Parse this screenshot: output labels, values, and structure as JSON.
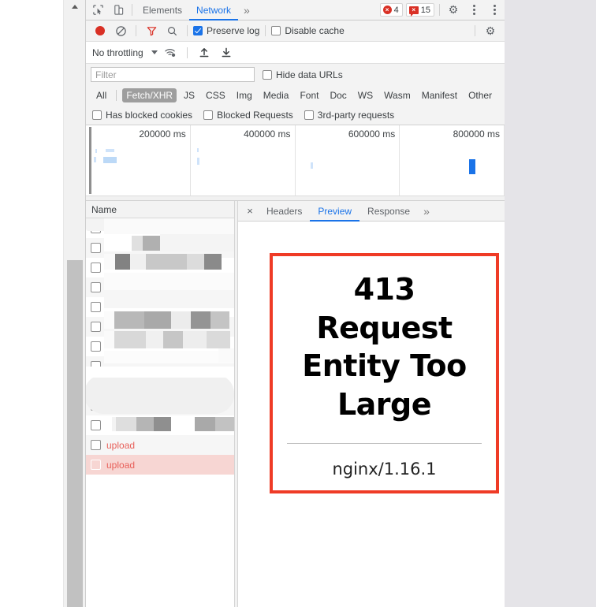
{
  "devtools": {
    "tabs": [
      {
        "label": "Elements",
        "active": false
      },
      {
        "label": "Network",
        "active": true
      }
    ],
    "more_tabs_glyph": "»",
    "inspect_icon": "inspect-element-icon",
    "device_icon": "device-toolbar-icon",
    "errors": {
      "count": "4",
      "glyph": "×"
    },
    "issues": {
      "count": "15",
      "glyph": "×"
    },
    "settings_glyph": "⚙",
    "accent": "#1a73e8",
    "error_color": "#d93025"
  },
  "network_toolbar": {
    "record_tooltip": "record-button",
    "clear_tooltip": "clear-button",
    "filter_tooltip": "filter-button",
    "search_tooltip": "search-button",
    "preserve_log": {
      "label": "Preserve log",
      "checked": true
    },
    "disable_cache": {
      "label": "Disable cache",
      "checked": false
    },
    "network_settings_glyph": "⚙"
  },
  "throttle": {
    "value": "No throttling",
    "wifi_icon": "network-conditions-icon",
    "import_icon": "import-har-icon",
    "export_icon": "export-har-icon"
  },
  "filter": {
    "placeholder": "Filter",
    "value": "",
    "hide_data_urls": {
      "label": "Hide data URLs",
      "checked": false
    },
    "types": [
      {
        "label": "All",
        "active": false
      },
      {
        "label": "Fetch/XHR",
        "active": true
      },
      {
        "label": "JS",
        "active": false
      },
      {
        "label": "CSS",
        "active": false
      },
      {
        "label": "Img",
        "active": false
      },
      {
        "label": "Media",
        "active": false
      },
      {
        "label": "Font",
        "active": false
      },
      {
        "label": "Doc",
        "active": false
      },
      {
        "label": "WS",
        "active": false
      },
      {
        "label": "Wasm",
        "active": false
      },
      {
        "label": "Manifest",
        "active": false
      },
      {
        "label": "Other",
        "active": false
      }
    ],
    "blocked_options": [
      {
        "label": "Has blocked cookies",
        "checked": false
      },
      {
        "label": "Blocked Requests",
        "checked": false
      },
      {
        "label": "3rd-party requests",
        "checked": false
      }
    ]
  },
  "overview": {
    "ticks": [
      "200000 ms",
      "400000 ms",
      "600000 ms",
      "800000 ms"
    ]
  },
  "requests": {
    "column_header": "Name",
    "rows": [
      {
        "name": "",
        "redacted": true,
        "error": false,
        "selected": false
      },
      {
        "name": "",
        "redacted": true,
        "error": false,
        "selected": false
      },
      {
        "name": "",
        "redacted": true,
        "error": false,
        "selected": false
      },
      {
        "name": "",
        "redacted": true,
        "error": false,
        "selected": false
      },
      {
        "name": "",
        "redacted": true,
        "error": false,
        "selected": false
      },
      {
        "name": "",
        "redacted": true,
        "error": false,
        "selected": false
      },
      {
        "name": "",
        "redacted": true,
        "error": false,
        "selected": false
      },
      {
        "name": "",
        "redacted": true,
        "error": false,
        "selected": false
      },
      {
        "name": "",
        "redacted": true,
        "error": false,
        "selected": false
      },
      {
        "name": "",
        "redacted": true,
        "error": false,
        "selected": false
      },
      {
        "name": "",
        "redacted": true,
        "error": false,
        "selected": false
      },
      {
        "name": "upload",
        "redacted": false,
        "error": true,
        "selected": false
      },
      {
        "name": "upload",
        "redacted": false,
        "error": true,
        "selected": true
      }
    ],
    "selected_row_bg": "#f7d6d3",
    "error_text_color": "#e8605a"
  },
  "detail": {
    "close_glyph": "×",
    "tabs": [
      {
        "label": "Headers",
        "active": false
      },
      {
        "label": "Preview",
        "active": true
      },
      {
        "label": "Response",
        "active": false
      }
    ],
    "more_tabs_glyph": "»"
  },
  "preview": {
    "title": "413 Request Entity Too Large",
    "server": "nginx/1.16.1",
    "annotation_color": "#ef3b26"
  }
}
